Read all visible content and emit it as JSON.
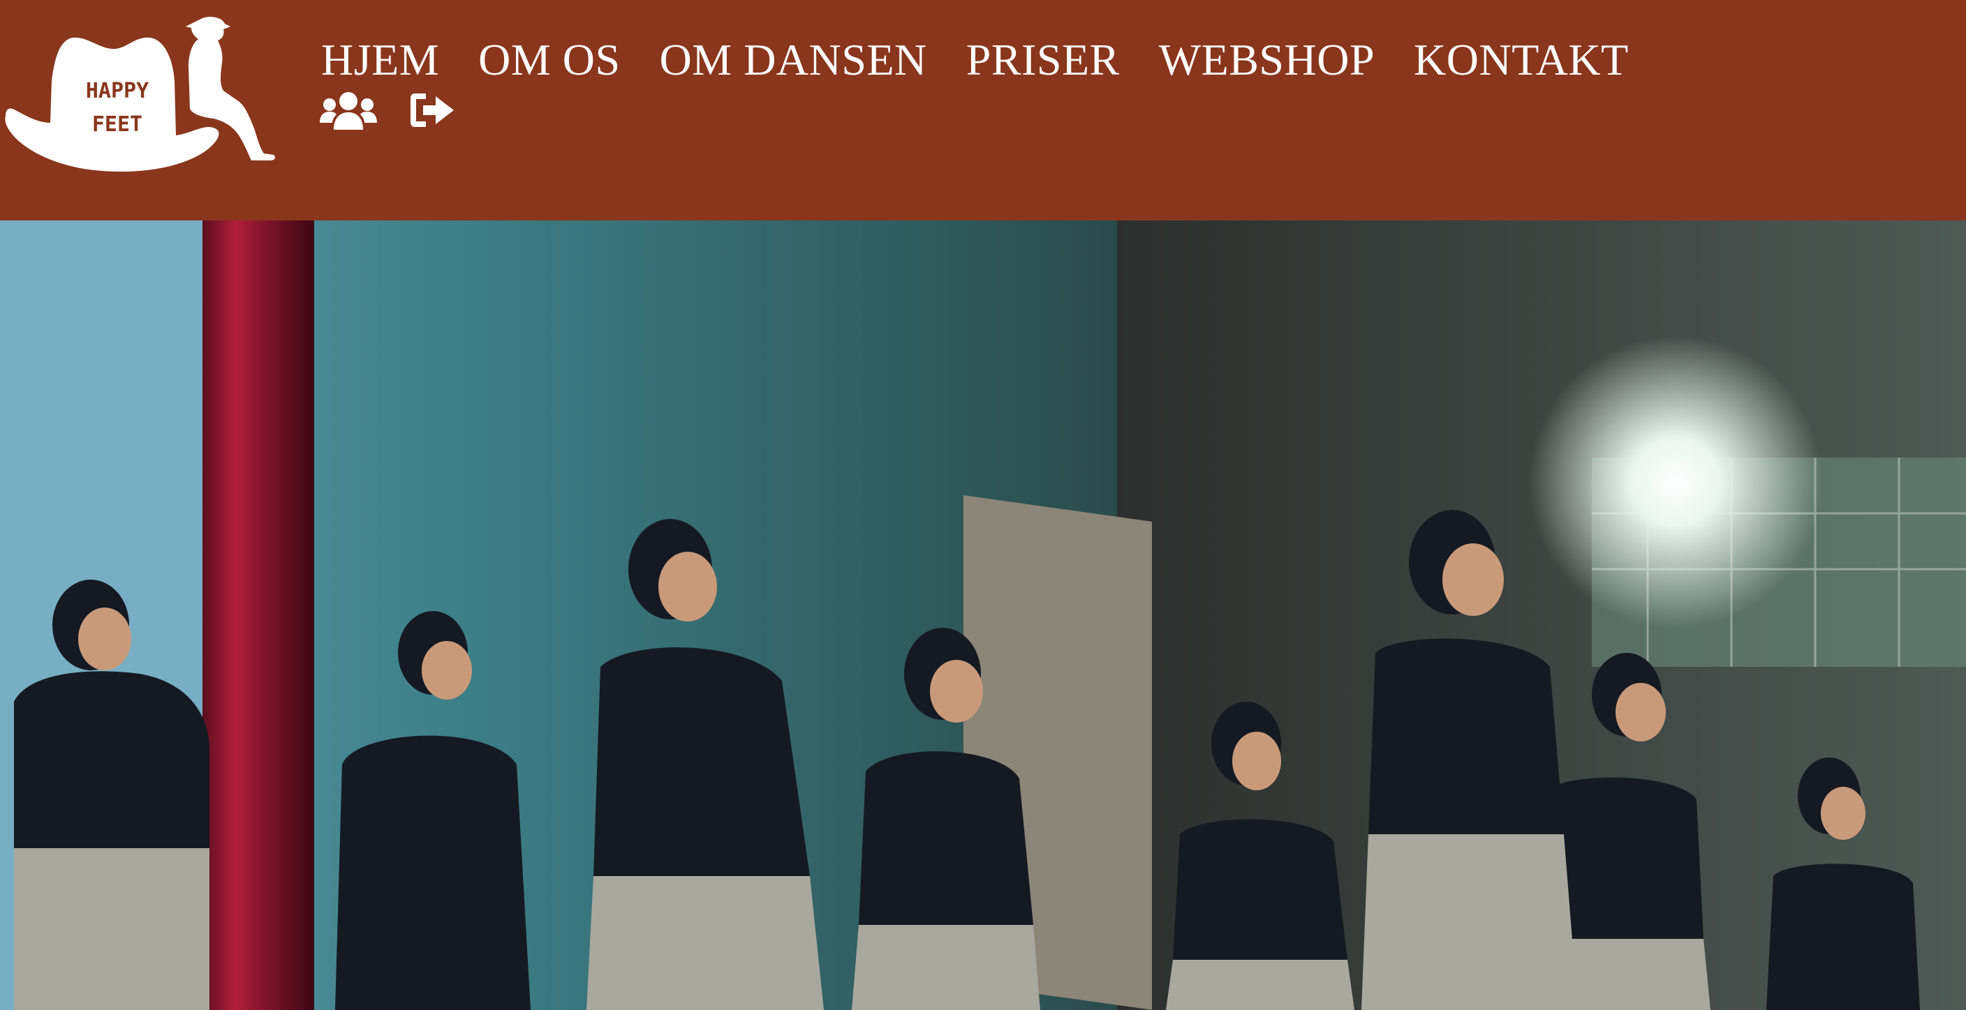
{
  "header": {
    "background_color": "#8a361d",
    "logo": {
      "text_line1": "HAPPY",
      "text_line2": "FEET",
      "icon": "cowboy-hat-logo"
    },
    "nav": [
      {
        "label": "HJEM"
      },
      {
        "label": "OM OS"
      },
      {
        "label": "OM DANSEN"
      },
      {
        "label": "PRISER"
      },
      {
        "label": "WEBSHOP"
      },
      {
        "label": "KONTAKT"
      }
    ],
    "icons": [
      {
        "name": "users-icon"
      },
      {
        "name": "sign-out-icon"
      }
    ]
  },
  "hero": {
    "image": "dancers-performing-on-stage-photo"
  }
}
